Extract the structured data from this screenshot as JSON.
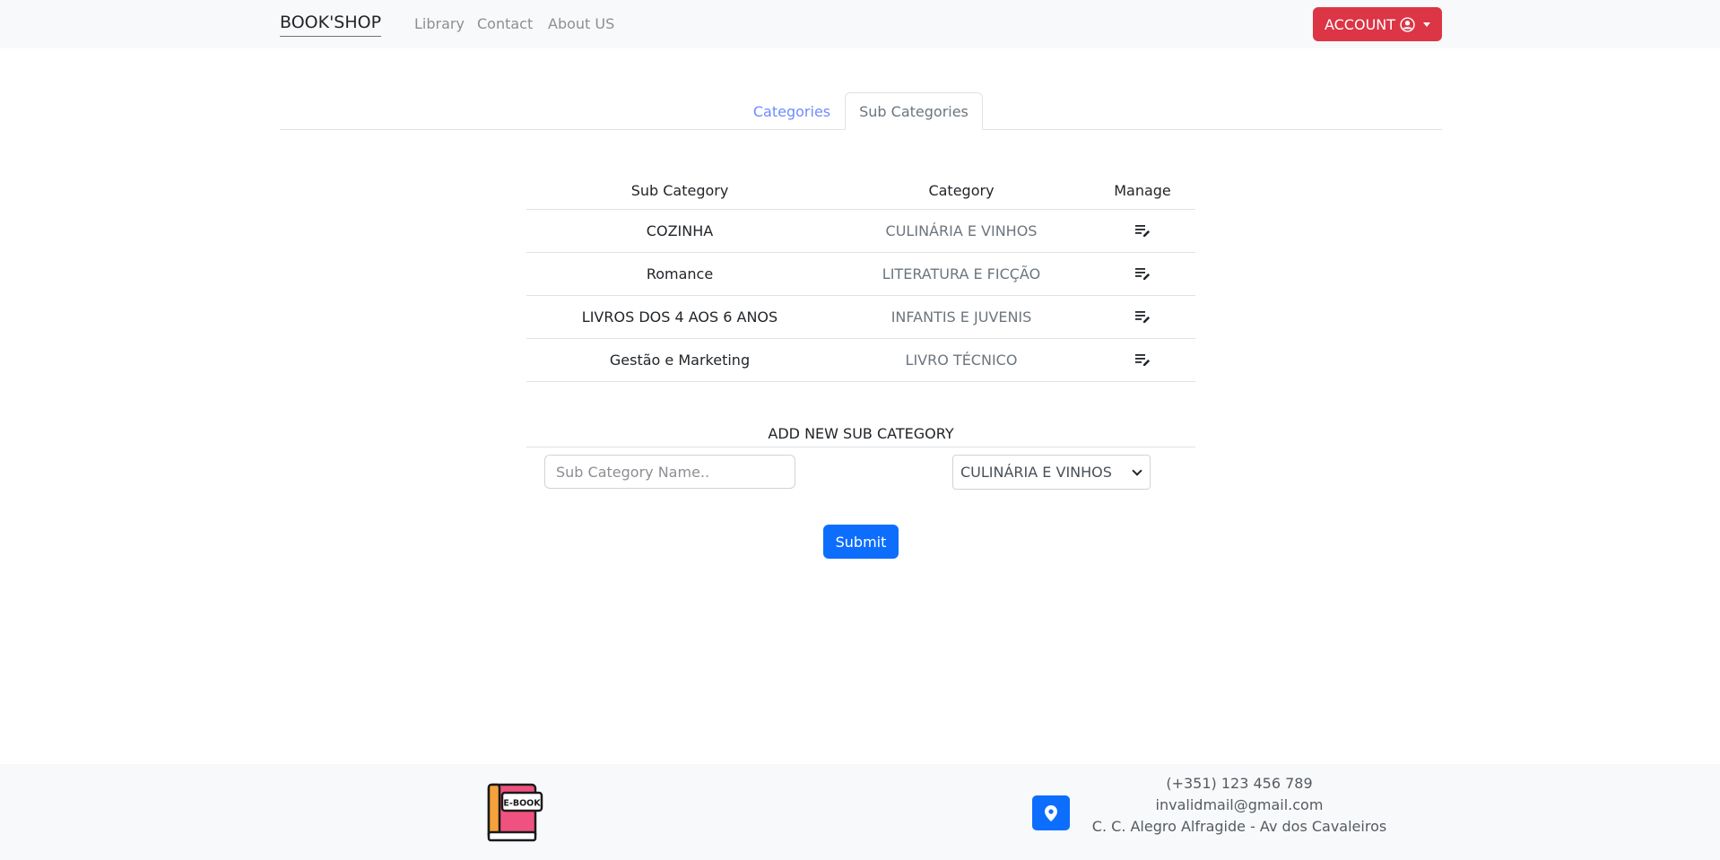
{
  "navbar": {
    "brand": "BOOK'SHOP",
    "links": [
      "Library",
      "Contact",
      "About US"
    ],
    "account_label": "ACCOUNT"
  },
  "tabs": [
    {
      "label": "Categories",
      "active": false
    },
    {
      "label": "Sub Categories",
      "active": true
    }
  ],
  "table": {
    "headers": [
      "Sub Category",
      "Category",
      "Manage"
    ],
    "rows": [
      {
        "sub_category": "COZINHA",
        "category": "CULINÁRIA E VINHOS",
        "manage_icon": "edit-list-icon"
      },
      {
        "sub_category": "Romance",
        "category": "LITERATURA E FICÇÃO",
        "manage_icon": "edit-list-icon"
      },
      {
        "sub_category": "LIVROS DOS 4 AOS 6 ANOS",
        "category": "INFANTIS E JUVENIS",
        "manage_icon": "edit-list-icon"
      },
      {
        "sub_category": "Gestão e Marketing",
        "category": "LIVRO TÉCNICO",
        "manage_icon": "edit-list-icon"
      }
    ]
  },
  "add_form": {
    "title": "ADD NEW SUB CATEGORY",
    "name_placeholder": "Sub Category Name..",
    "name_value": "",
    "category_selected": "CULINÁRIA E VINHOS",
    "submit_label": "Submit"
  },
  "footer": {
    "logo_text": "E-BOOK",
    "phone": "(+351) 123 456 789",
    "email": "invalidmail@gmail.com",
    "address": "C. C. Alegro Alfragide - Av dos Cavaleiros"
  },
  "colors": {
    "navbar_bg": "#f8f9fa",
    "account_btn": "#dc3545",
    "primary": "#0d6efd",
    "tab_link": "#6d8cff"
  }
}
